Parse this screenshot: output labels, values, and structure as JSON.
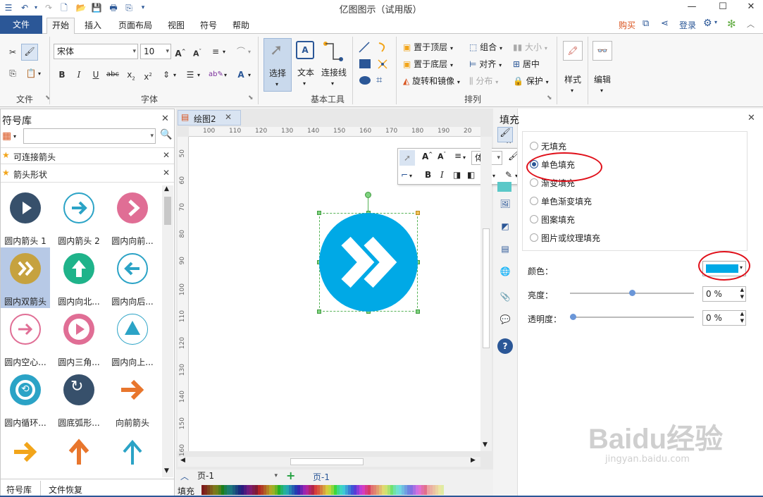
{
  "app": {
    "title": "亿图图示（试用版）"
  },
  "menu": {
    "file": "文件",
    "tabs": [
      "开始",
      "插入",
      "页面布局",
      "视图",
      "符号",
      "帮助"
    ],
    "buy": "购买",
    "login": "登录"
  },
  "ribbon": {
    "font_name": "宋体",
    "font_size": "10",
    "group_file": "文件",
    "group_font": "字体",
    "group_basic": "基本工具",
    "group_arrange": "排列",
    "select": "选择",
    "text": "文本",
    "connector": "连接线",
    "bring_top": "置于顶层",
    "send_bottom": "置于底层",
    "rotate": "旋转和镜像",
    "group": "组合",
    "align": "对齐",
    "distribute": "分布",
    "size": "大小",
    "center": "居中",
    "protect": "保护",
    "style": "样式",
    "edit": "编辑"
  },
  "library": {
    "title": "符号库",
    "search_placeholder": "",
    "categories": [
      "可连接箭头",
      "箭头形状"
    ],
    "items": [
      "圆内箭头 1",
      "圆内箭头 2",
      "圆内向前...",
      "圆内双箭头",
      "圆内向北...",
      "圆内向后...",
      "圆内空心...",
      "圆内三角...",
      "圆内向上...",
      "圆内循环...",
      "圆底弧形...",
      "向前箭头"
    ],
    "bottom_tabs": [
      "符号库",
      "文件恢复"
    ]
  },
  "document": {
    "tab": "绘图2",
    "ruler_top": [
      "100",
      "110",
      "120",
      "130",
      "140",
      "150",
      "160",
      "170",
      "180",
      "190",
      "20"
    ],
    "ruler_left": [
      "50",
      "60",
      "70",
      "80",
      "90",
      "100",
      "110",
      "120",
      "130",
      "140",
      "150",
      "160"
    ],
    "page_selector": "页-1",
    "page_tab": "页-1",
    "fill_label": "填充"
  },
  "minitoolbar": {
    "font": "体"
  },
  "fill_panel": {
    "title": "填充",
    "options": [
      "无填充",
      "单色填充",
      "渐变填充",
      "单色渐变填充",
      "图案填充",
      "图片或纹理填充"
    ],
    "color_label": "颜色：",
    "brightness_label": "亮度：",
    "brightness_value": "0 %",
    "brightness_level": 0.5,
    "transparency_label": "透明度：",
    "transparency_value": "0 %",
    "transparency_level": 0
  },
  "colors": {
    "brand": "#2b5797",
    "shape_fill": "#00a9e6",
    "swatch": "#00a9e6",
    "highlight": "#e0101a"
  },
  "watermark": {
    "brand": "Baidu经验",
    "url": "jingyan.baidu.com"
  }
}
